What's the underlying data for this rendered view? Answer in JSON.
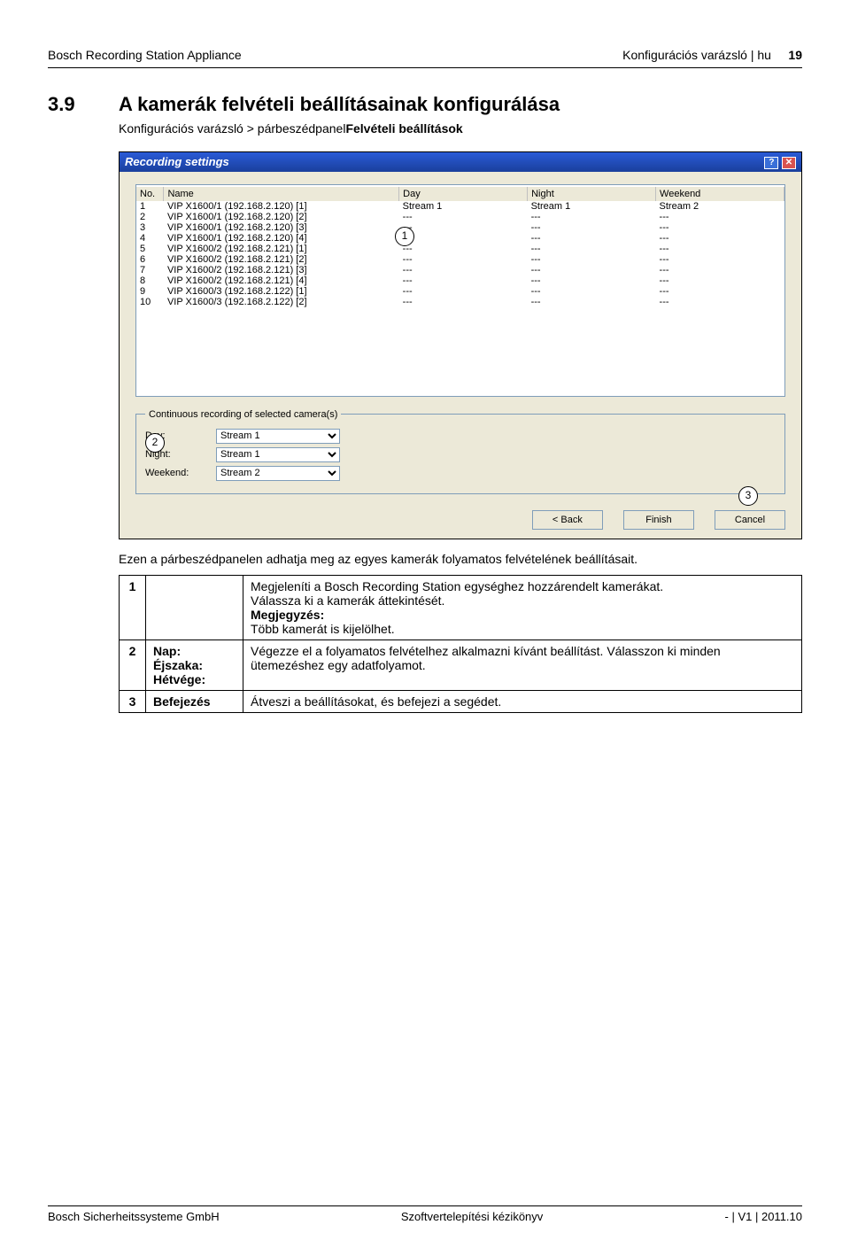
{
  "header": {
    "left": "Bosch Recording Station Appliance",
    "right_section": "Konfigurációs varázsló | hu",
    "page": "19"
  },
  "section": {
    "number": "3.9",
    "title": "A kamerák felvételi beállításainak konfigurálása",
    "breadcrumb_pre": "Konfigurációs varázsló > párbeszédpanel",
    "breadcrumb_bold": "Felvételi beállítások"
  },
  "dialog": {
    "title": "Recording settings",
    "help_glyph": "?",
    "close_glyph": "✕",
    "columns": {
      "no": "No.",
      "name": "Name",
      "day": "Day",
      "night": "Night",
      "weekend": "Weekend"
    },
    "rows": [
      {
        "no": "1",
        "name": "VIP X1600/1 (192.168.2.120) [1]",
        "day": "Stream 1",
        "night": "Stream 1",
        "weekend": "Stream 2"
      },
      {
        "no": "2",
        "name": "VIP X1600/1 (192.168.2.120) [2]",
        "day": "---",
        "night": "---",
        "weekend": "---"
      },
      {
        "no": "3",
        "name": "VIP X1600/1 (192.168.2.120) [3]",
        "day": "---",
        "night": "---",
        "weekend": "---"
      },
      {
        "no": "4",
        "name": "VIP X1600/1 (192.168.2.120) [4]",
        "day": "---",
        "night": "---",
        "weekend": "---"
      },
      {
        "no": "5",
        "name": "VIP X1600/2 (192.168.2.121) [1]",
        "day": "---",
        "night": "---",
        "weekend": "---"
      },
      {
        "no": "6",
        "name": "VIP X1600/2 (192.168.2.121) [2]",
        "day": "---",
        "night": "---",
        "weekend": "---"
      },
      {
        "no": "7",
        "name": "VIP X1600/2 (192.168.2.121) [3]",
        "day": "---",
        "night": "---",
        "weekend": "---"
      },
      {
        "no": "8",
        "name": "VIP X1600/2 (192.168.2.121) [4]",
        "day": "---",
        "night": "---",
        "weekend": "---"
      },
      {
        "no": "9",
        "name": "VIP X1600/3 (192.168.2.122) [1]",
        "day": "---",
        "night": "---",
        "weekend": "---"
      },
      {
        "no": "10",
        "name": "VIP X1600/3 (192.168.2.122) [2]",
        "day": "---",
        "night": "---",
        "weekend": "---"
      }
    ],
    "fieldset_legend": "Continuous recording of selected camera(s)",
    "day_label": "Day:",
    "night_label": "Night:",
    "weekend_label": "Weekend:",
    "day_value": "Stream 1",
    "night_value": "Stream 1",
    "weekend_value": "Stream 2",
    "btn_back": "< Back",
    "btn_finish": "Finish",
    "btn_cancel": "Cancel"
  },
  "callouts": {
    "c1": "1",
    "c2": "2",
    "c3": "3"
  },
  "caption": "Ezen a párbeszédpanelen adhatja meg az egyes kamerák folyamatos felvételének beállításait.",
  "desc": {
    "r1": {
      "num": "1",
      "label": "",
      "text_1": "Megjeleníti a Bosch Recording Station egységhez hozzárendelt kamerákat.",
      "text_2": "Válassza ki a kamerák áttekintését.",
      "note": "Megjegyzés:",
      "text_3": "Több kamerát is kijelölhet."
    },
    "r2": {
      "num": "2",
      "label_1": "Nap:",
      "label_2": "Éjszaka:",
      "label_3": "Hétvége:",
      "text": "Végezze el a folyamatos felvételhez alkalmazni kívánt beállítást. Válasszon ki minden ütemezéshez egy adatfolyamot."
    },
    "r3": {
      "num": "3",
      "label": "Befejezés",
      "text": "Átveszi a beállításokat, és befejezi a segédet."
    }
  },
  "footer": {
    "left": "Bosch Sicherheitssysteme GmbH",
    "center": "Szoftvertelepítési kézikönyv",
    "right": "- | V1 | 2011.10"
  }
}
